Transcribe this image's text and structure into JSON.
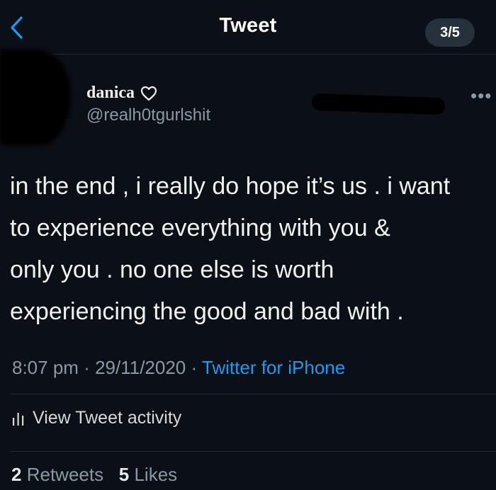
{
  "header": {
    "title": "Tweet",
    "counter": "3/5"
  },
  "author": {
    "name": "danica",
    "handle": "@realh0tgurlshit",
    "more": "•••"
  },
  "tweet": {
    "lines": [
      "in the end , i really do hope it’s us . i want",
      "to experience everything with you &",
      "only you . no one else is worth",
      "experiencing the good and bad with ."
    ]
  },
  "meta": {
    "time": "8:07 pm",
    "sep1": " · ",
    "date": "29/11/2020",
    "sep2": " · ",
    "source": "Twitter for iPhone"
  },
  "activity": {
    "label": "View Tweet activity"
  },
  "stats": {
    "retweets_count": "2",
    "retweets_label": "Retweets",
    "likes_count": "5",
    "likes_label": "Likes"
  },
  "colors": {
    "background": "#0b0f16",
    "accent": "#1d9bf0",
    "muted": "#8b98a5"
  }
}
